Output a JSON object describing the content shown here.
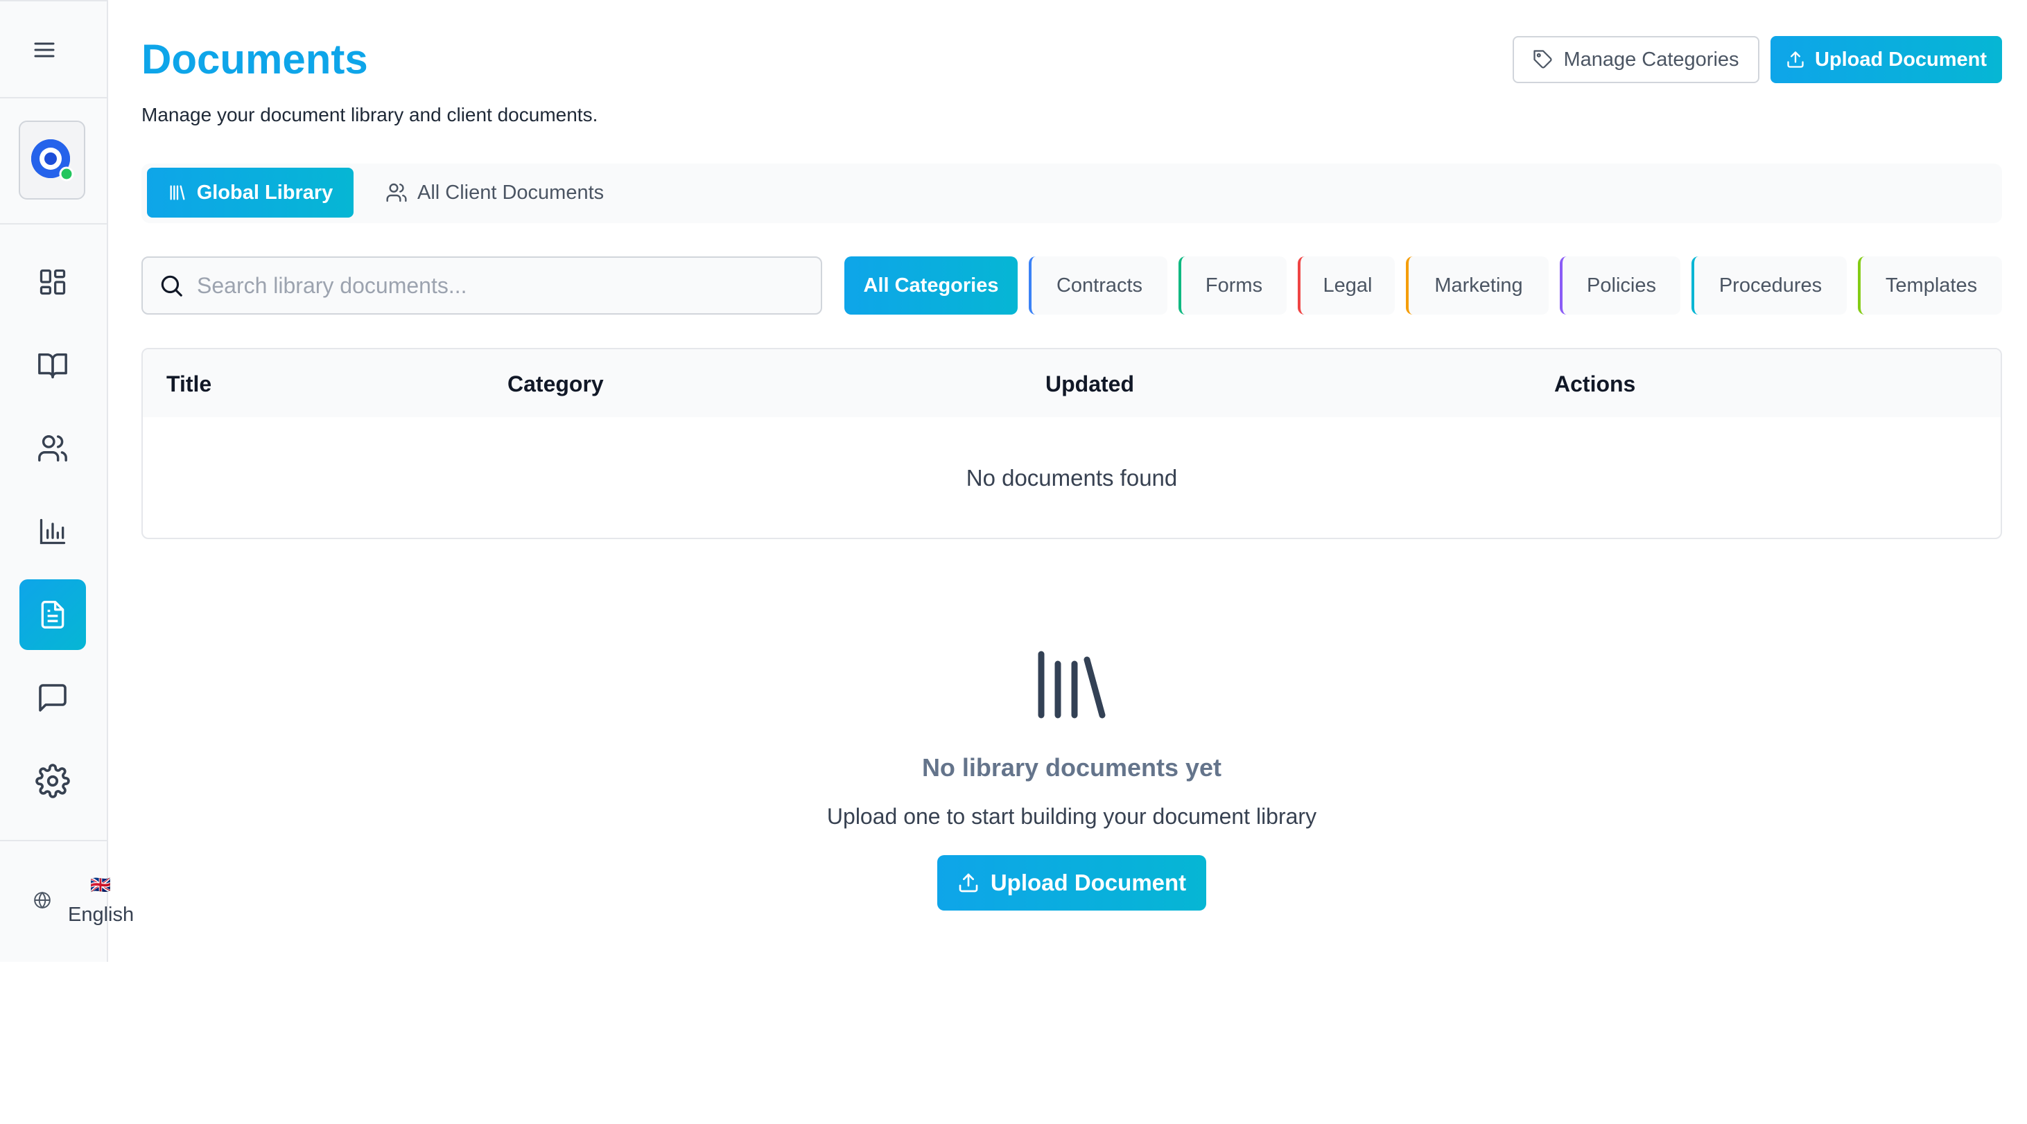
{
  "sidebar": {
    "menu_icon": "hamburger-menu-icon",
    "logo_icon": "app-logo-icon",
    "status_color": "#22c55e",
    "nav_items": [
      {
        "icon": "dashboard-icon",
        "active": false
      },
      {
        "icon": "book-icon",
        "active": false
      },
      {
        "icon": "users-icon",
        "active": false
      },
      {
        "icon": "bar-chart-icon",
        "active": false
      },
      {
        "icon": "document-icon",
        "active": true
      },
      {
        "icon": "chat-icon",
        "active": false
      },
      {
        "icon": "settings-gear-icon",
        "active": false
      }
    ],
    "language": {
      "flag": "🇬🇧",
      "label": "English",
      "icon": "globe-icon"
    }
  },
  "header": {
    "title": "Documents",
    "subtitle": "Manage your document library and client documents.",
    "manage_categories_label": "Manage Categories",
    "upload_label": "Upload Document"
  },
  "tabs": [
    {
      "label": "Global Library",
      "active": true
    },
    {
      "label": "All Client Documents",
      "active": false
    }
  ],
  "search": {
    "placeholder": "Search library documents...",
    "value": ""
  },
  "categories": [
    {
      "label": "All Categories",
      "active": true,
      "color": "#0ea5e9"
    },
    {
      "label": "Contracts",
      "active": false,
      "color": "#3b82f6"
    },
    {
      "label": "Forms",
      "active": false,
      "color": "#10b981"
    },
    {
      "label": "Legal",
      "active": false,
      "color": "#ef4444"
    },
    {
      "label": "Marketing",
      "active": false,
      "color": "#f59e0b"
    },
    {
      "label": "Policies",
      "active": false,
      "color": "#8b5cf6"
    },
    {
      "label": "Procedures",
      "active": false,
      "color": "#06b6d4"
    },
    {
      "label": "Templates",
      "active": false,
      "color": "#84cc16"
    }
  ],
  "table": {
    "columns": [
      "Title",
      "Category",
      "Updated",
      "Actions"
    ],
    "empty_message": "No documents found"
  },
  "empty_state": {
    "icon": "library-icon",
    "title": "No library documents yet",
    "subtitle": "Upload one to start building your document library",
    "button_label": "Upload Document"
  },
  "colors": {
    "accent": "#0ea5e9",
    "accent_end": "#06b6d4"
  }
}
